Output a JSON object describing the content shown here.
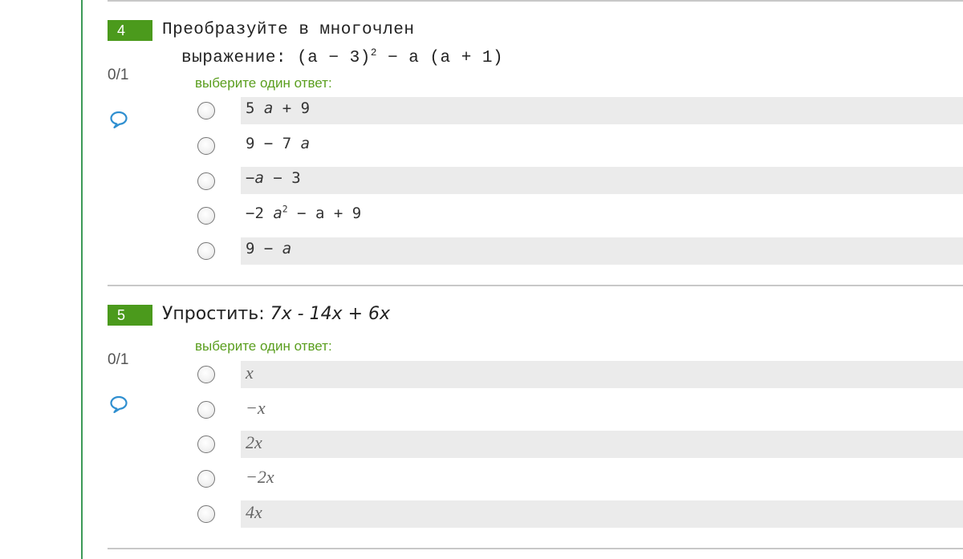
{
  "questions": [
    {
      "number": "4",
      "grade": "0/1",
      "text_line1": "Преобразуйте в многочлен",
      "text_line2_label": "выражение: ",
      "text_line2_expr": "(a − 3)",
      "text_line2_exp": "2",
      "text_line2_tail": " − a (a + 1)",
      "prompt": "выберите один ответ:",
      "options": [
        {
          "pre": "5 ",
          "var": "a",
          "post": " + 9",
          "exp": "",
          "tail": ""
        },
        {
          "pre": "9 − 7 ",
          "var": "a",
          "post": "",
          "exp": "",
          "tail": ""
        },
        {
          "pre": "−",
          "var": "a",
          "post": " − 3",
          "exp": "",
          "tail": ""
        },
        {
          "pre": "−2 ",
          "var": "a",
          "post": "",
          "exp": "2",
          "tail": " − a + 9"
        },
        {
          "pre": "9 − ",
          "var": "a",
          "post": "",
          "exp": "",
          "tail": ""
        }
      ]
    },
    {
      "number": "5",
      "grade": "0/1",
      "text_label": "Упростить: ",
      "text_expr": "7x - 14x + 6x",
      "prompt": "выберите один ответ:",
      "options": [
        "x",
        "−x",
        "2x",
        "−2x",
        "4x"
      ]
    }
  ],
  "icons": {
    "comment": "speech-bubble-icon"
  },
  "colors": {
    "accent": "#4b9a1c",
    "prompt": "#5a9e1e",
    "band": "#ebebeb",
    "rule": "#3c9a58"
  }
}
